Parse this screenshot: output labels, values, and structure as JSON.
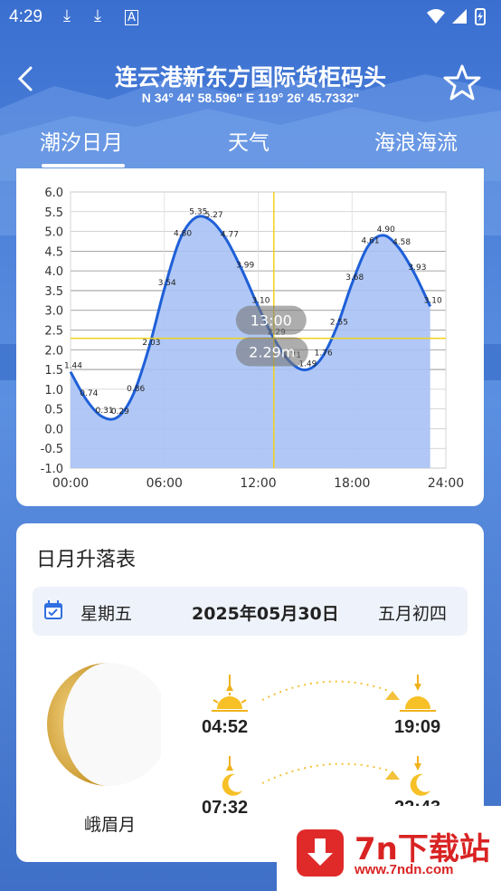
{
  "status_bar": {
    "time": "4:29"
  },
  "header": {
    "title": "连云港新东方国际货柜码头",
    "coords": "N 34° 44' 58.596\"   E 119° 26' 45.7332\""
  },
  "tabs": [
    {
      "label": "潮汐日月",
      "selected": true
    },
    {
      "label": "天气"
    },
    {
      "label": "海浪海流"
    }
  ],
  "chart_data": {
    "type": "area",
    "xlabel": "",
    "ylabel": "",
    "x_ticks": [
      "00:00",
      "06:00",
      "12:00",
      "18:00",
      "24:00"
    ],
    "y_ticks": [
      "6.0",
      "5.5",
      "5.0",
      "4.5",
      "4.0",
      "3.5",
      "3.0",
      "2.5",
      "2.0",
      "1.5",
      "1.0",
      "0.5",
      "0.0",
      "-0.5",
      "-1.0"
    ],
    "xlim": [
      0,
      24
    ],
    "ylim": [
      -1.0,
      6.0
    ],
    "grid": true,
    "x": [
      0,
      1,
      2,
      3,
      4,
      5,
      6,
      7,
      8,
      9,
      10,
      11,
      12,
      13,
      14,
      15,
      16,
      17,
      18,
      19,
      20,
      21,
      22,
      23
    ],
    "values": [
      1.44,
      0.74,
      0.31,
      0.29,
      0.86,
      2.03,
      3.54,
      4.8,
      5.35,
      5.27,
      4.77,
      3.99,
      3.1,
      2.29,
      1.71,
      1.49,
      1.76,
      2.55,
      3.68,
      4.61,
      4.9,
      4.58,
      3.93,
      3.1
    ],
    "labels": [
      "1.44",
      "0.74",
      "0.31",
      "0.29",
      "0.86",
      "2.03",
      "3.54",
      "4.80",
      "5.35",
      "5.27",
      "4.77",
      "3.99",
      "3.10",
      "2.29",
      "1.71",
      "1.49",
      "1.76",
      "2.55",
      "3.68",
      "4.61",
      "4.90",
      "4.58",
      "3.93",
      "3.10"
    ],
    "cursor": {
      "x": 13,
      "y": 2.29,
      "time_label": "13:00",
      "value_label": "2.29m"
    },
    "colors": {
      "line": "#1e5fd8",
      "fill": "#a9c2f5",
      "cursor": "#f2d21b",
      "grid": "#999999"
    }
  },
  "sun_table": {
    "title": "日月升落表",
    "weekday": "星期五",
    "date": "2025年05月30日",
    "lunar_date": "五月初四",
    "moon_phase": "峨眉月",
    "sunrise": "04:52",
    "sunset": "19:09",
    "moonrise": "07:32",
    "moonset": "22:43"
  },
  "watermark": {
    "text": "7n下载站",
    "url": "www.7ndn.com"
  }
}
